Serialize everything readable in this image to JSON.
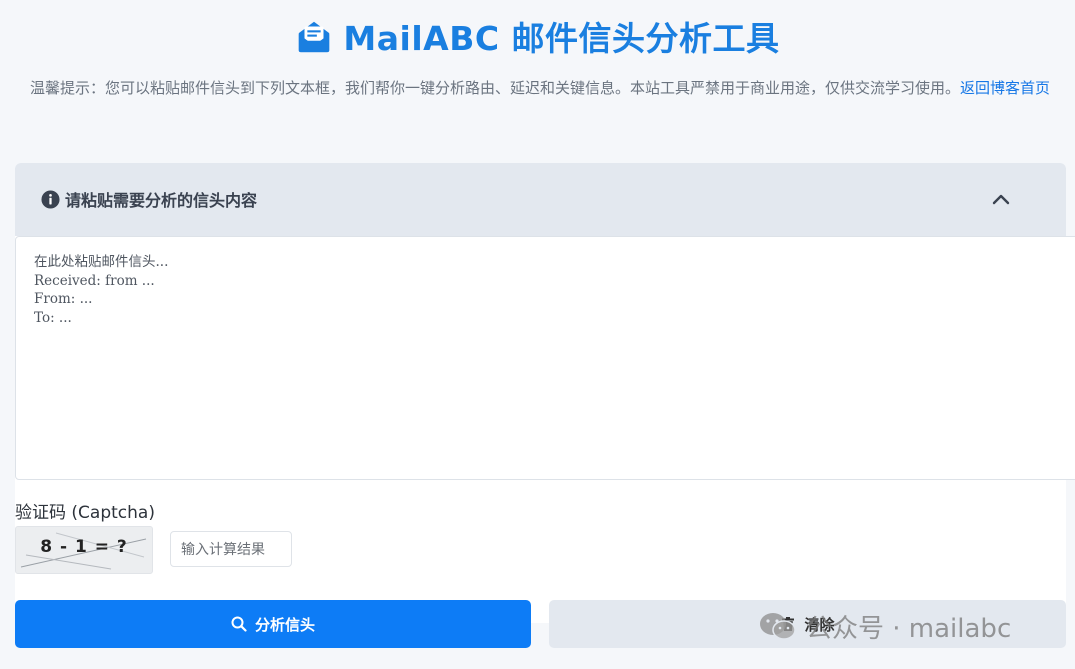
{
  "header": {
    "title": "MailABC 邮件信头分析工具",
    "logo_icon": "envelope-open-text-icon",
    "brand_color": "#1a7fe0"
  },
  "tip": {
    "text": "温馨提示：您可以粘贴邮件信头到下列文本框，我们帮你一键分析路由、延迟和关键信息。本站工具严禁用于商业用途，仅供交流学习使用。",
    "link_label": "返回博客首页"
  },
  "panel": {
    "header_label": "请粘贴需要分析的信头内容",
    "info_icon": "info-circle-icon",
    "collapse_icon": "chevron-up-icon",
    "textarea_placeholder": "在此处粘贴邮件信头...\nReceived: from ...\nFrom: ...\nTo: ..."
  },
  "captcha": {
    "label": "验证码 (Captcha)",
    "challenge": "8 - 1 = ?",
    "input_placeholder": "输入计算结果"
  },
  "actions": {
    "analyze_label": "分析信头",
    "analyze_icon": "search-icon",
    "analyze_color": "#0d7cf6",
    "clear_label": "清除",
    "clear_icon": "trash-icon"
  },
  "watermark": {
    "text": "公众号 · mailabc",
    "icon": "wechat-icon"
  }
}
